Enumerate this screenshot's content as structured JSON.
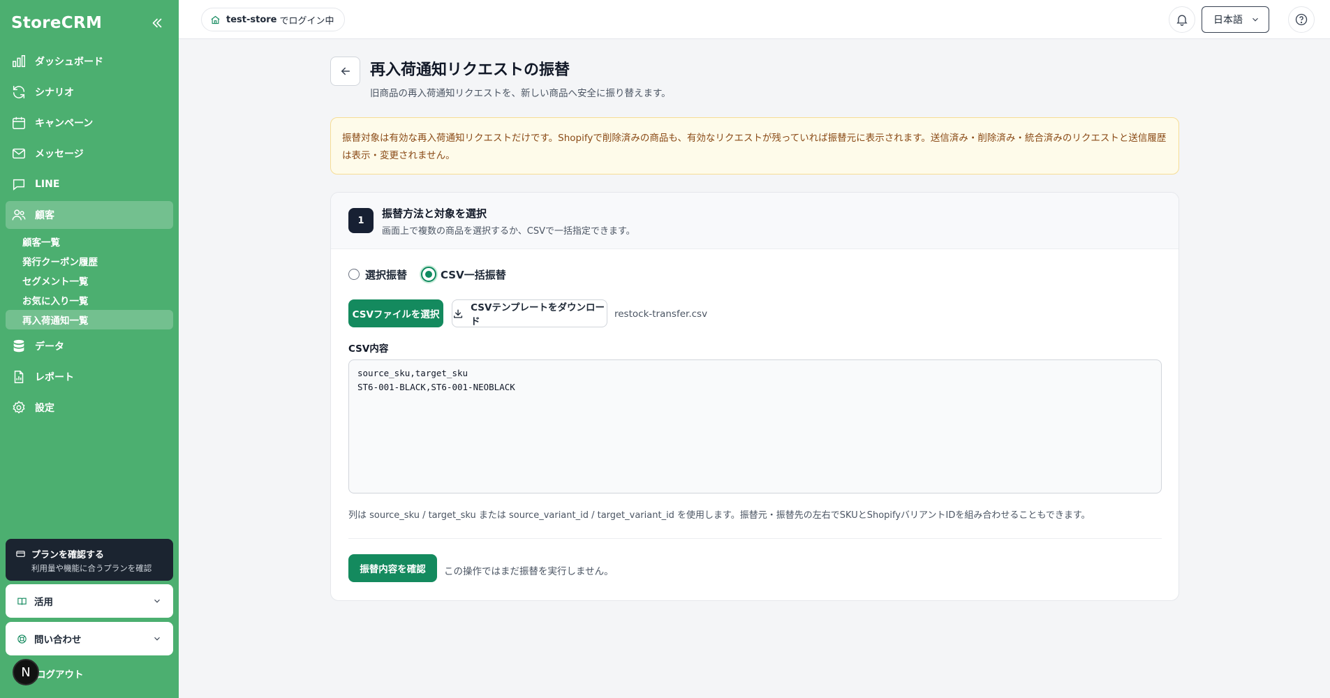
{
  "sidebar": {
    "logo": "StoreCRM",
    "nav": [
      {
        "label": "ダッシュボード",
        "icon": "bar-chart-icon"
      },
      {
        "label": "シナリオ",
        "icon": "refresh-icon"
      },
      {
        "label": "キャンペーン",
        "icon": "calendar-icon"
      },
      {
        "label": "メッセージ",
        "icon": "mail-icon"
      },
      {
        "label": "LINE",
        "icon": "chat-icon"
      },
      {
        "label": "顧客",
        "icon": "users-icon"
      }
    ],
    "customer_sub": [
      "顧客一覧",
      "発行クーポン履歴",
      "セグメント一覧",
      "お気に入り一覧",
      "再入荷通知一覧"
    ],
    "nav_bottom": [
      {
        "label": "データ",
        "icon": "database-icon"
      },
      {
        "label": "レポート",
        "icon": "report-icon"
      },
      {
        "label": "設定",
        "icon": "gear-icon"
      }
    ],
    "plan_title": "プランを確認する",
    "plan_sub": "利用量や機能に合うプランを確認",
    "usage_label": "活用",
    "contact_label": "問い合わせ",
    "logout_label": "ログアウト",
    "avatar_letter": "N"
  },
  "header": {
    "store_name": "test-store",
    "store_suffix": "でログイン中",
    "language": "日本語"
  },
  "page": {
    "title": "再入荷通知リクエストの振替",
    "subtitle": "旧商品の再入荷通知リクエストを、新しい商品へ安全に振り替えます。",
    "notice": "振替対象は有効な再入荷通知リクエストだけです。Shopifyで削除済みの商品も、有効なリクエストが残っていれば振替元に表示されます。送信済み・削除済み・統合済みのリクエストと送信履歴は表示・変更されません。"
  },
  "step1": {
    "number": "1",
    "title": "振替方法と対象を選択",
    "subtitle": "画面上で複数の商品を選択するか、CSVで一括指定できます。",
    "mode_select": "選択振替",
    "mode_csv": "CSV一括振替",
    "selected_mode": "csv",
    "choose_file": "CSVファイルを選択",
    "download_template": "CSVテンプレートをダウンロード",
    "filename": "restock-transfer.csv",
    "csv_label": "CSV内容",
    "csv_content": "source_sku,target_sku\nST6-001-BLACK,ST6-001-NEOBLACK",
    "hint": "列は source_sku / target_sku または source_variant_id / target_variant_id を使用します。振替元・振替先の左右でSKUとShopifyバリアントIDを組み合わせることもできます。",
    "confirm_button": "振替内容を確認",
    "confirm_note": "この操作ではまだ振替を実行しません。"
  },
  "colors": {
    "sidebar": "#4caf70",
    "primary": "#148a5e",
    "notice_bg": "#fefbea",
    "notice_text": "#8a4a16"
  }
}
